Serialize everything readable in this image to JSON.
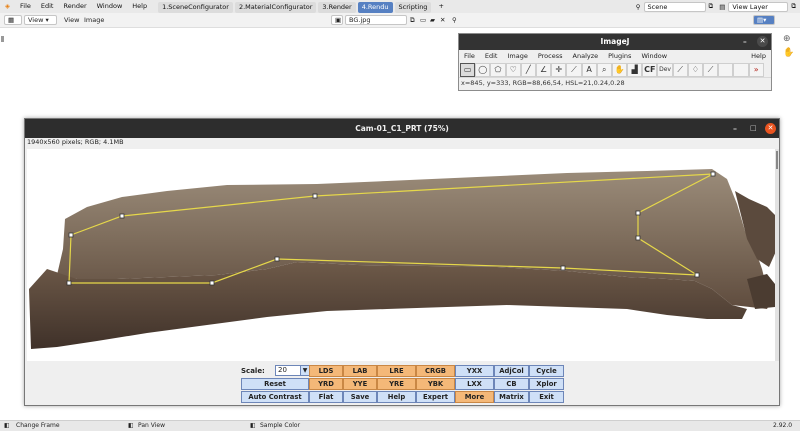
{
  "topbar": {
    "menus": [
      "File",
      "Edit",
      "Render",
      "Window",
      "Help"
    ],
    "workspaces": [
      "1.SceneConfigurator",
      "2.MaterialConfigurator",
      "3.Render",
      "4.Rendu",
      "Scripting"
    ],
    "active_workspace": "4.Rendu",
    "add_tab": "+",
    "scene": "Scene",
    "view_layer": "View Layer"
  },
  "editor_header": {
    "mode": "View",
    "menus": [
      "View",
      "Image"
    ],
    "image_name": "BG.jpg"
  },
  "imagej": {
    "title": "ImageJ",
    "menus": [
      "File",
      "Edit",
      "Image",
      "Process",
      "Analyze",
      "Plugins",
      "Window",
      "Help"
    ],
    "tools": [
      "rectangle-tool-icon",
      "oval-tool-icon",
      "polygon-tool-icon",
      "freehand-tool-icon",
      "line-tool-icon",
      "angle-tool-icon",
      "point-tool-icon",
      "wand-tool-icon",
      "text-tool-icon",
      "magnifier-icon",
      "hand-tool-icon",
      "dropper-tool-icon",
      "cf-tool",
      "dev-tool",
      "brush-tool-icon",
      "flood-tool-icon",
      "pipette-tool-icon",
      "blank-tool",
      "blank-tool",
      "more-tools-icon"
    ],
    "tool_labels": {
      "cf": "CF",
      "dev": "Dev",
      "text": "A"
    },
    "status": "x=845, y=333, RGB=88,66,54, HSL=21,0.24,0.28"
  },
  "image_window": {
    "title": "Cam-01_C1_PRT (75%)",
    "info": "1940x560 pixels; RGB; 4.1MB",
    "colors": {
      "selection": "#e6d84a",
      "surface": "#7a6b5c"
    }
  },
  "controls": {
    "scale_label": "Scale:",
    "scale_value": "20",
    "rows": [
      [
        "LDS",
        "LAB",
        "LRE",
        "CRGB",
        "YXX",
        "AdjCol",
        "Cycle"
      ],
      [
        "Reset",
        "YRD",
        "YYE",
        "YRE",
        "YBK",
        "LXX",
        "CB",
        "Xplor"
      ],
      [
        "Auto Contrast",
        "Flat",
        "Save",
        "Help",
        "Expert",
        "More",
        "Matrix",
        "Exit"
      ]
    ],
    "highlighted": [
      "LDS",
      "LAB",
      "LRE",
      "CRGB",
      "YRD",
      "YYE",
      "YRE",
      "YBK",
      "More"
    ]
  },
  "statusbar": {
    "left": "Change Frame",
    "middle": "Pan View",
    "right": "Sample Color",
    "version": "2.92.0"
  }
}
